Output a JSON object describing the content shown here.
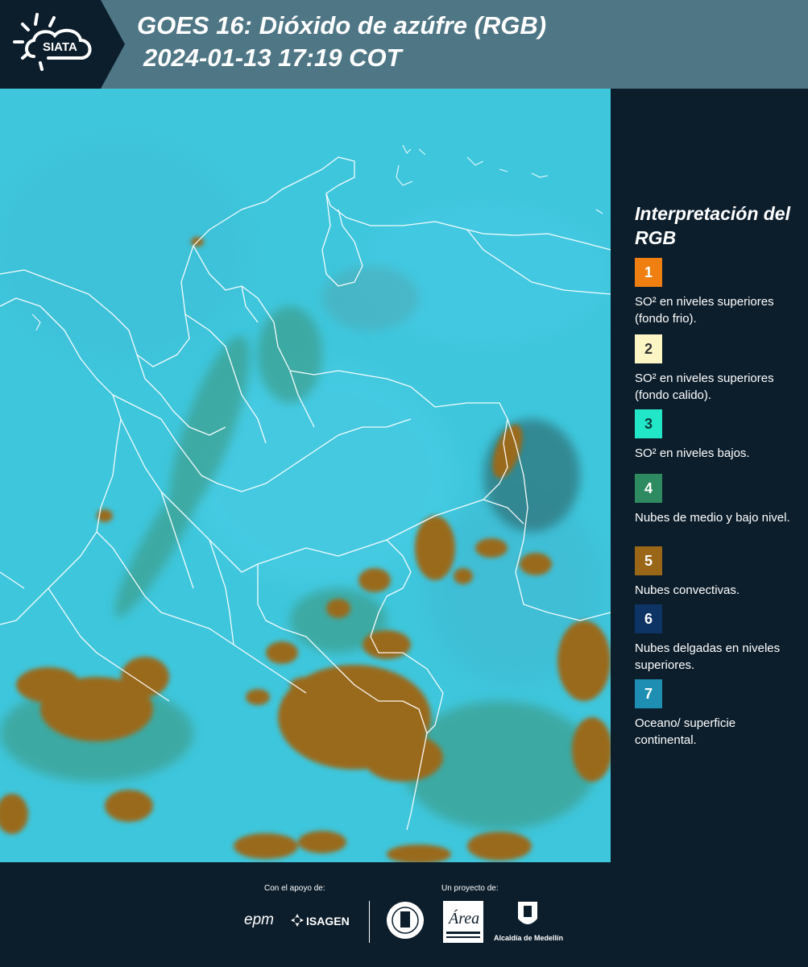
{
  "header": {
    "logo_text": "SIATA",
    "title": "GOES 16: Dióxido de azúfre (RGB)",
    "subtitle": "2024-01-13 17:19 COT"
  },
  "legend": {
    "title": "Interpretación del RGB",
    "items": [
      {
        "number": "1",
        "text": "SO² en niveles superiores (fondo frio).",
        "color": "#f07f12",
        "num_color": "#ffffff"
      },
      {
        "number": "2",
        "text": "SO² en niveles superiores (fondo calido).",
        "color": "#fdf5c4",
        "num_color": "#333333"
      },
      {
        "number": "3",
        "text": "SO² en niveles bajos.",
        "color": "#22e6c8",
        "num_color": "#0c3a3a"
      },
      {
        "number": "4",
        "text": "Nubes de medio y bajo nivel.",
        "color": "#2e8a60",
        "num_color": "#ffffff"
      },
      {
        "number": "5",
        "text": "Nubes convectivas.",
        "color": "#9a6618",
        "num_color": "#ffffff"
      },
      {
        "number": "6",
        "text": "Nubes delgadas en niveles superiores.",
        "color": "#0e3466",
        "num_color": "#ffffff"
      },
      {
        "number": "7",
        "text": "Oceano/ superficie continental.",
        "color": "#1e8fb3",
        "num_color": "#ffffff"
      }
    ]
  },
  "footer": {
    "support_label": "Con el apoyo de:",
    "project_label": "Un proyecto de:",
    "sponsors": [
      "epm",
      "ISAGEN"
    ],
    "partners": [
      "Área Metropolitana Valle de Aburrá",
      "Alcaldía de Medellín"
    ]
  },
  "colors": {
    "header_bg": "#4f7685",
    "panel_bg": "#0c1e2c",
    "map_background": "#3ec6dc",
    "cloud_convective": "#9a6a1e",
    "cloud_mid": "#2f8a66"
  }
}
